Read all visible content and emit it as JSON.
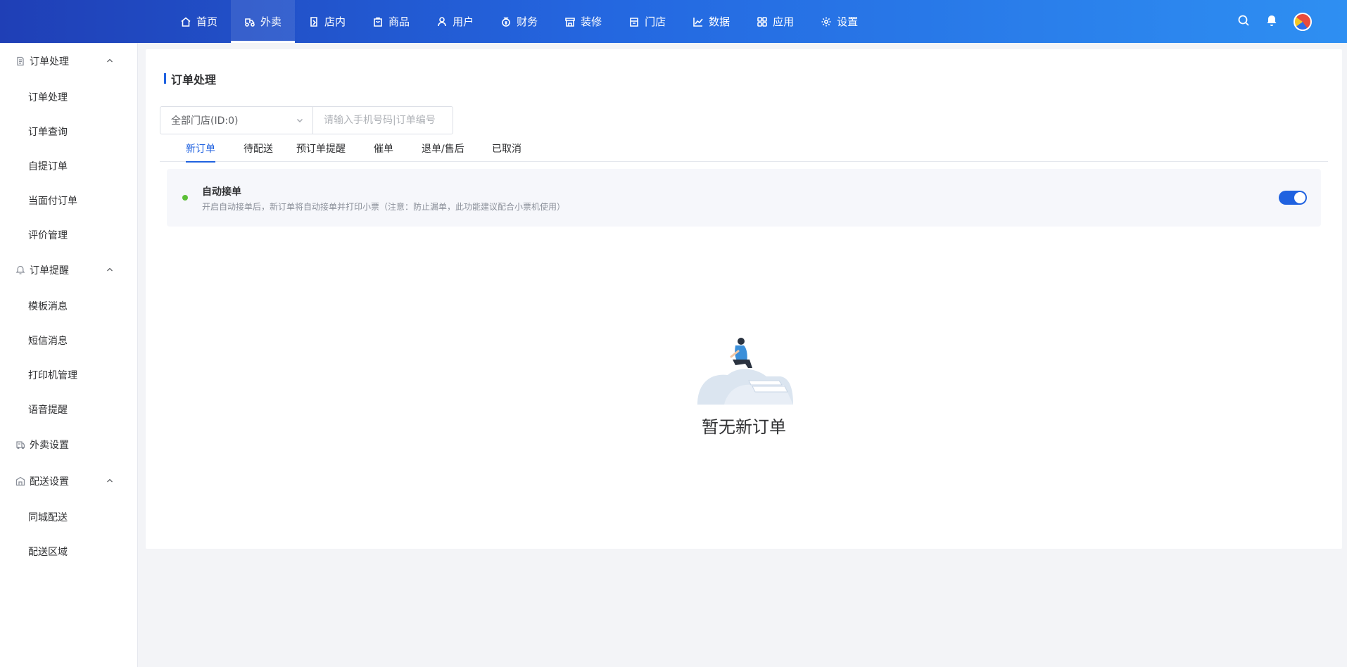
{
  "topnav": {
    "items": [
      {
        "label": "首页",
        "icon": "home-icon"
      },
      {
        "label": "外卖",
        "icon": "delivery-icon",
        "active": true
      },
      {
        "label": "店内",
        "icon": "dine-in-icon"
      },
      {
        "label": "商品",
        "icon": "goods-icon"
      },
      {
        "label": "用户",
        "icon": "user-icon"
      },
      {
        "label": "财务",
        "icon": "finance-icon"
      },
      {
        "label": "装修",
        "icon": "decorate-icon"
      },
      {
        "label": "门店",
        "icon": "store-icon"
      },
      {
        "label": "数据",
        "icon": "chart-icon"
      },
      {
        "label": "应用",
        "icon": "apps-icon"
      },
      {
        "label": "设置",
        "icon": "gear-icon"
      }
    ]
  },
  "sidebar": {
    "groups": [
      {
        "label": "订单处理",
        "icon": "document-icon",
        "items": [
          "订单处理",
          "订单查询",
          "自提订单",
          "当面付订单",
          "评价管理"
        ]
      },
      {
        "label": "订单提醒",
        "icon": "bell-icon",
        "items": [
          "模板消息",
          "短信消息",
          "打印机管理",
          "语音提醒"
        ]
      },
      {
        "label": "外卖设置",
        "icon": "takeout-icon",
        "items": []
      },
      {
        "label": "配送设置",
        "icon": "delivery-settings-icon",
        "items": [
          "同城配送",
          "配送区域"
        ]
      }
    ]
  },
  "main": {
    "title": "订单处理",
    "store_select": "全部门店(ID:0)",
    "search_placeholder": "请输入手机号码|订单编号",
    "tabs": [
      "新订单",
      "待配送",
      "预订单提醒",
      "催单",
      "退单/售后",
      "已取消"
    ],
    "active_tab": "新订单",
    "auto_accept": {
      "title": "自动接单",
      "description": "开启自动接单后，新订单将自动接单并打印小票（注意：防止漏单，此功能建议配合小票机使用）",
      "enabled": true
    },
    "empty_text": "暂无新订单"
  },
  "colors": {
    "accent": "#2062e0",
    "topbar_start": "#1f3fb6",
    "topbar_end": "#2e8ff2",
    "status_dot": "#5bbf37"
  }
}
